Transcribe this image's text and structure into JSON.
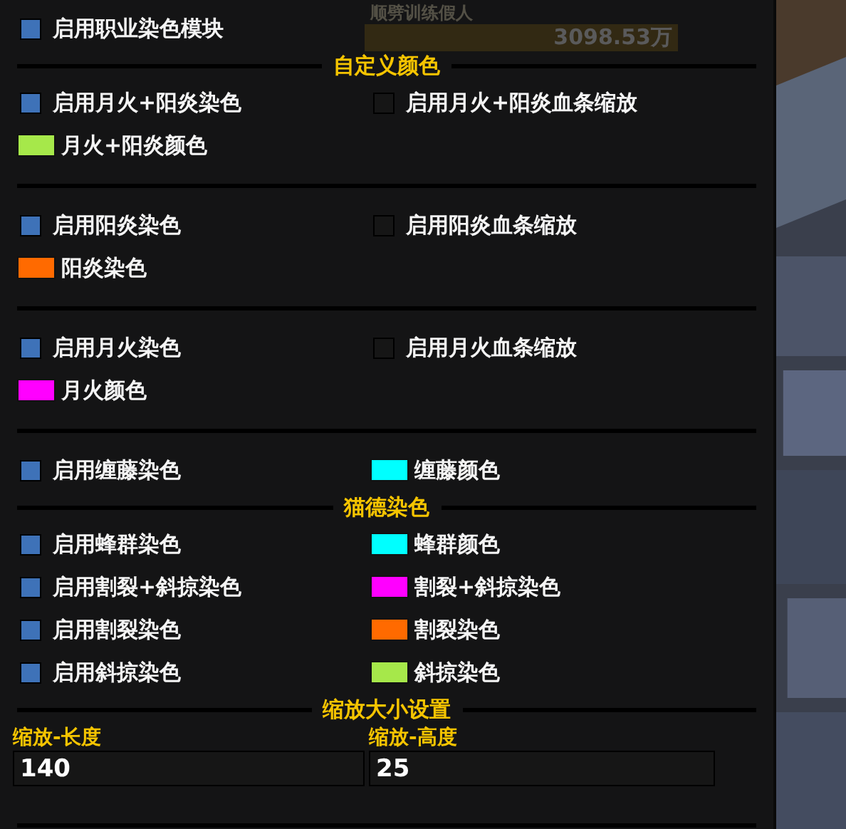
{
  "background": {
    "unit_name": "顺劈训练假人",
    "unit_health": "3098.53万"
  },
  "rows": [
    {
      "kind": "row",
      "items": [
        {
          "kind": "checkbox",
          "label": "启用职业染色模块",
          "checked": true
        }
      ]
    },
    {
      "kind": "header",
      "title": "自定义颜色"
    },
    {
      "kind": "row",
      "items": [
        {
          "kind": "checkbox",
          "label": "启用月火+阳炎染色",
          "checked": true
        },
        {
          "kind": "checkbox",
          "label": "启用月火+阳炎血条缩放",
          "checked": false
        }
      ]
    },
    {
      "kind": "row",
      "items": [
        {
          "kind": "swatch",
          "label": "月火+阳炎颜色",
          "color": "#a6e84a"
        }
      ]
    },
    {
      "kind": "divider"
    },
    {
      "kind": "row",
      "items": [
        {
          "kind": "checkbox",
          "label": "启用阳炎染色",
          "checked": true
        },
        {
          "kind": "checkbox",
          "label": "启用阳炎血条缩放",
          "checked": false
        }
      ]
    },
    {
      "kind": "row",
      "items": [
        {
          "kind": "swatch",
          "label": "阳炎染色",
          "color": "#ff6a00"
        }
      ]
    },
    {
      "kind": "divider"
    },
    {
      "kind": "row",
      "items": [
        {
          "kind": "checkbox",
          "label": "启用月火染色",
          "checked": true
        },
        {
          "kind": "checkbox",
          "label": "启用月火血条缩放",
          "checked": false
        }
      ]
    },
    {
      "kind": "row",
      "items": [
        {
          "kind": "swatch",
          "label": "月火颜色",
          "color": "#ff00ff"
        }
      ]
    },
    {
      "kind": "divider"
    },
    {
      "kind": "row",
      "items": [
        {
          "kind": "checkbox",
          "label": "启用缠藤染色",
          "checked": true
        },
        {
          "kind": "swatch",
          "label": "缠藤颜色",
          "color": "#00ffff"
        }
      ]
    },
    {
      "kind": "header",
      "title": "猫德染色"
    },
    {
      "kind": "row",
      "items": [
        {
          "kind": "checkbox",
          "label": "启用蜂群染色",
          "checked": true
        },
        {
          "kind": "swatch",
          "label": "蜂群颜色",
          "color": "#00ffff"
        }
      ]
    },
    {
      "kind": "row",
      "items": [
        {
          "kind": "checkbox",
          "label": "启用割裂+斜掠染色",
          "checked": true
        },
        {
          "kind": "swatch",
          "label": "割裂+斜掠染色",
          "color": "#ff00ff"
        }
      ]
    },
    {
      "kind": "row",
      "items": [
        {
          "kind": "checkbox",
          "label": "启用割裂染色",
          "checked": true
        },
        {
          "kind": "swatch",
          "label": "割裂染色",
          "color": "#ff6a00"
        }
      ]
    },
    {
      "kind": "row",
      "items": [
        {
          "kind": "checkbox",
          "label": "启用斜掠染色",
          "checked": true
        },
        {
          "kind": "swatch",
          "label": "斜掠染色",
          "color": "#a6e84a"
        }
      ]
    },
    {
      "kind": "header",
      "title": "缩放大小设置"
    },
    {
      "kind": "inputs",
      "items": [
        {
          "label": "缩放-长度",
          "value": "140"
        },
        {
          "label": "缩放-高度",
          "value": "25"
        }
      ]
    }
  ]
}
